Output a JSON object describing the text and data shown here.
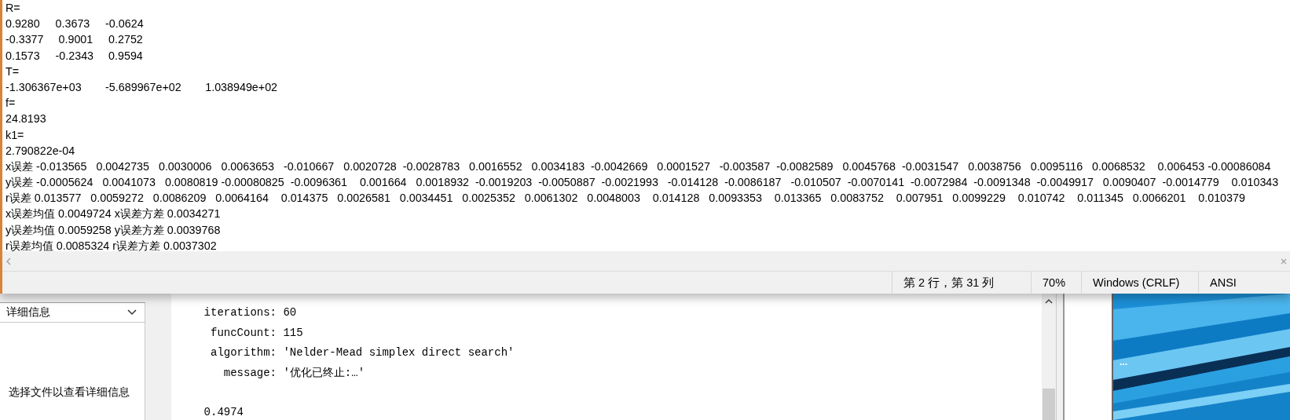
{
  "notepad": {
    "lines": [
      "R=",
      "0.9280\t0.3673\t-0.0624",
      "-0.3377\t 0.9001\t 0.2752",
      "0.1573\t-0.2343\t 0.9594",
      "T=",
      "-1.306367e+03\t-5.689967e+02\t1.038949e+02",
      "f=",
      "24.8193",
      "k1=",
      "2.790822e-04",
      "x误差 -0.013565   0.0042735   0.0030006   0.0063653   -0.010667   0.0020728  -0.0028783   0.0016552   0.0034183  -0.0042669   0.0001527   -0.003587  -0.0082589   0.0045768  -0.0031547   0.0038756   0.0095116   0.0068532    0.006453 -0.00086084",
      "y误差 -0.0005624   0.0041073   0.0080819 -0.00080825  -0.0096361    0.001664   0.0018932  -0.0019203  -0.0050887  -0.0021993   -0.014128  -0.0086187   -0.010507  -0.0070141  -0.0072984  -0.0091348  -0.0049917   0.0090407  -0.0014779    0.010343",
      "r误差 0.013577   0.0059272   0.0086209   0.0064164    0.014375   0.0026581   0.0034451   0.0025352   0.0061302   0.0048003    0.014128   0.0093353    0.013365   0.0083752    0.007951   0.0099229    0.010742    0.011345   0.0066201    0.010379",
      "x误差均值 0.0049724 x误差方差 0.0034271",
      "y误差均值 0.0059258 y误差方差 0.0039768",
      "r误差均值 0.0085324 r误差方差 0.0037302"
    ],
    "status_bar": [
      "第 2 行，第 31 列",
      "70%",
      "Windows (CRLF)",
      "ANSI"
    ]
  },
  "details_panel": {
    "dropdown": "详细信息",
    "message": "选择文件以查看详细信息"
  },
  "command_window": {
    "lines": [
      "    iterations: 60",
      "     funcCount: 115",
      "     algorithm: 'Nelder-Mead simplex direct search'",
      "       message: '优化已终止:…'"
    ],
    "result": "    0.4974"
  },
  "thumbnail": {
    "kind": "picture",
    "overlay": "..."
  }
}
